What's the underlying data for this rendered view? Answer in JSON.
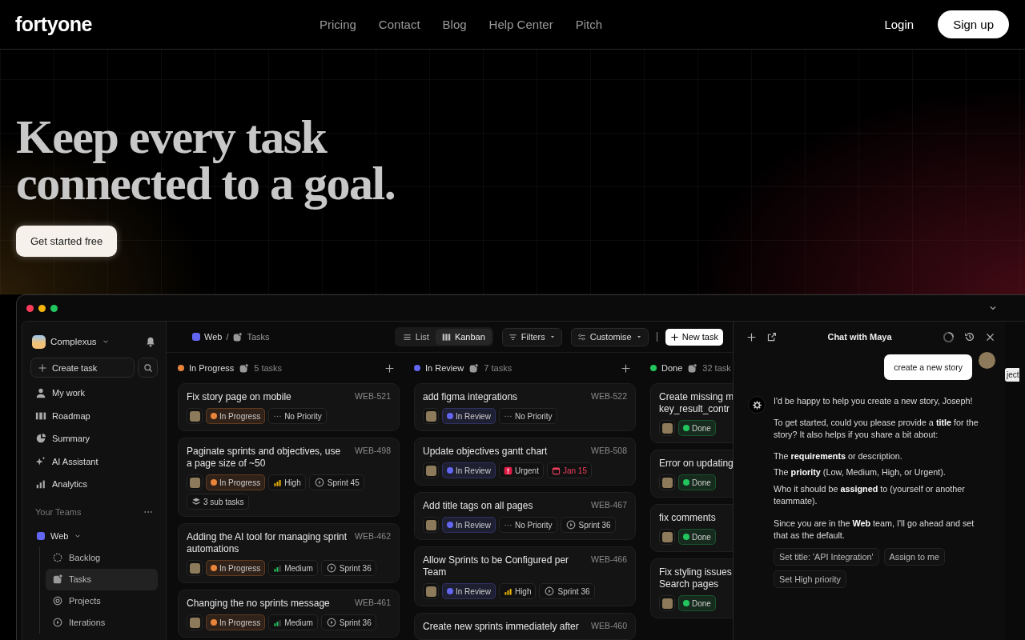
{
  "nav": {
    "logo": "fortyone",
    "links": [
      "Pricing",
      "Contact",
      "Blog",
      "Help Center",
      "Pitch"
    ],
    "login": "Login",
    "signup": "Sign up"
  },
  "hero": {
    "heading_lines": [
      "Keep every task",
      "connected to a goal."
    ],
    "cta": "Get started free"
  },
  "app": {
    "sidebar": {
      "workspace": "Complexus",
      "create": "Create task",
      "items": [
        {
          "label": "My work",
          "selected": false
        },
        {
          "label": "Roadmap",
          "selected": false
        },
        {
          "label": "Summary",
          "selected": false
        },
        {
          "label": "AI Assistant",
          "selected": false
        },
        {
          "label": "Analytics",
          "selected": false
        }
      ],
      "teams_label": "Your Teams",
      "team": {
        "name": "Web",
        "color": "#6366f1",
        "expanded": true,
        "children": [
          {
            "label": "Backlog",
            "selected": false
          },
          {
            "label": "Tasks",
            "selected": true
          },
          {
            "label": "Projects",
            "selected": false
          },
          {
            "label": "Iterations",
            "selected": false
          }
        ]
      }
    },
    "breadcrumb": {
      "team": "Web",
      "separator": "/",
      "page": "Tasks"
    },
    "views": [
      {
        "label": "List",
        "selected": false
      },
      {
        "label": "Kanban",
        "selected": true
      }
    ],
    "toolbar": [
      "Filters",
      "Customise"
    ],
    "new_task": "New task",
    "columns": [
      {
        "name": "In Progress",
        "color": "#e8833a",
        "count": "5 tasks",
        "cards": [
          {
            "title": "Fix story page on mobile",
            "id": "WEB-521",
            "chips": [
              {
                "kind": "status",
                "label": "In Progress"
              },
              {
                "kind": "none",
                "label": "No Priority"
              }
            ]
          },
          {
            "title": "Paginate sprints and objectives, use a page size of ~50",
            "id": "WEB-498",
            "chips": [
              {
                "kind": "status",
                "label": "In Progress"
              },
              {
                "kind": "high",
                "label": "High"
              },
              {
                "kind": "sprint",
                "label": "Sprint 45"
              },
              {
                "kind": "subtasks",
                "label": "3 sub tasks"
              }
            ]
          },
          {
            "title": "Adding the AI tool for managing sprint automations",
            "id": "WEB-462",
            "chips": [
              {
                "kind": "status",
                "label": "In Progress"
              },
              {
                "kind": "medium",
                "label": "Medium"
              },
              {
                "kind": "sprint",
                "label": "Sprint 36"
              }
            ]
          },
          {
            "title": "Changing the no sprints message",
            "id": "WEB-461",
            "chips": [
              {
                "kind": "status",
                "label": "In Progress"
              },
              {
                "kind": "medium",
                "label": "Medium"
              },
              {
                "kind": "sprint",
                "label": "Sprint 36"
              }
            ]
          }
        ]
      },
      {
        "name": "In Review",
        "color": "#6366f1",
        "count": "7 tasks",
        "cards": [
          {
            "title": "add figma integrations",
            "id": "WEB-522",
            "chips": [
              {
                "kind": "status",
                "label": "In Review"
              },
              {
                "kind": "none",
                "label": "No Priority"
              }
            ]
          },
          {
            "title": "Update objectives gantt chart",
            "id": "WEB-508",
            "chips": [
              {
                "kind": "status",
                "label": "In Review"
              },
              {
                "kind": "urgent",
                "label": "Urgent"
              },
              {
                "kind": "date",
                "label": "Jan 15"
              }
            ]
          },
          {
            "title": "Add title tags on all pages",
            "id": "WEB-467",
            "chips": [
              {
                "kind": "status",
                "label": "In Review"
              },
              {
                "kind": "none",
                "label": "No Priority"
              },
              {
                "kind": "sprint",
                "label": "Sprint 36"
              }
            ]
          },
          {
            "title": "Allow Sprints to be Configured per Team",
            "id": "WEB-466",
            "chips": [
              {
                "kind": "status",
                "label": "In Review"
              },
              {
                "kind": "high",
                "label": "High"
              },
              {
                "kind": "sprint",
                "label": "Sprint 36"
              }
            ]
          },
          {
            "title": "Create new sprints immediately after",
            "id": "WEB-460"
          }
        ]
      },
      {
        "name": "Done",
        "color": "#22c55e",
        "count": "32 task",
        "cards": [
          {
            "title": "Create missing m\nkey_result_contr",
            "chips": [
              {
                "kind": "status",
                "label": "Done"
              }
            ]
          },
          {
            "title": "Error on updating",
            "chips": [
              {
                "kind": "status",
                "label": "Done"
              }
            ]
          },
          {
            "title": "fix comments",
            "chips": [
              {
                "kind": "status",
                "label": "Done"
              }
            ]
          },
          {
            "title": "Fix styling issues\nSearch pages",
            "chips": [
              {
                "kind": "status",
                "label": "Done"
              }
            ]
          }
        ]
      }
    ],
    "chat": {
      "title": "Chat with Maya",
      "user_message": "create a new story",
      "reply": [
        "I'd be happy to help you create a new story, Joseph!",
        "To get started, could you please provide a **title** for the story? It also helps if you share a bit about:"
      ],
      "points": [
        "The **requirements** or description.",
        "The **priority** (Low, Medium, High, or Urgent).",
        "Who it should be **assigned** to (yourself or another teammate)."
      ],
      "closing": "Since you are in the **Web** team, I'll go ahead and set that as the default.",
      "suggestions": [
        "Set title: 'API Integration'",
        "Assign to me",
        "Set High priority"
      ]
    },
    "edge_tag": "ject"
  }
}
